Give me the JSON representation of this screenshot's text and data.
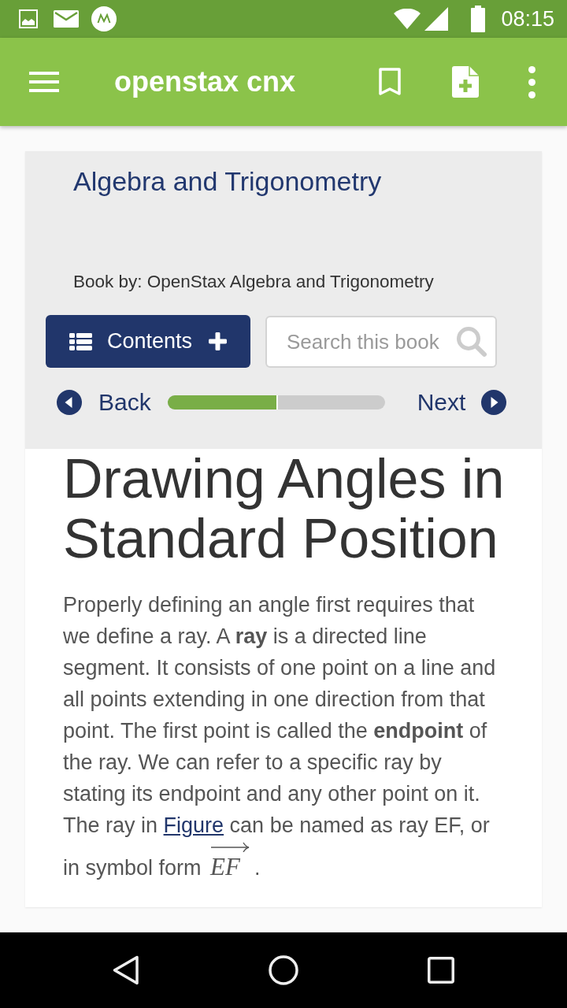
{
  "status_bar": {
    "time": "08:15"
  },
  "app_bar": {
    "title": "openstax cnx"
  },
  "book": {
    "title": "Algebra and Trigonometry",
    "byline": "Book by: OpenStax Algebra and Trigonometry"
  },
  "toolbar": {
    "contents_button": "Contents",
    "search": {
      "placeholder": "Search this book"
    }
  },
  "pager": {
    "back": "Back",
    "next": "Next",
    "progress": {
      "level": 0.51
    }
  },
  "section": {
    "heading": "Drawing Angles in Standard Position",
    "paragraph": [
      {
        "kind": "text",
        "text": "Properly defining an angle first requires that we define a ray. A **ray** is a directed line segment. It consists of one point on a line and all points extending in one direction from that point. The first point is called the **endpoint** of the ray. We can refer to a specific ray by stating its endpoint and any other point on it. The ray in "
      },
      {
        "kind": "link",
        "text": "Figure"
      },
      {
        "kind": "text",
        "text": " can be named as ray EF, or in symbol form "
      },
      {
        "kind": "vector",
        "text": "EF"
      },
      {
        "kind": "text",
        "text": "."
      }
    ]
  }
}
